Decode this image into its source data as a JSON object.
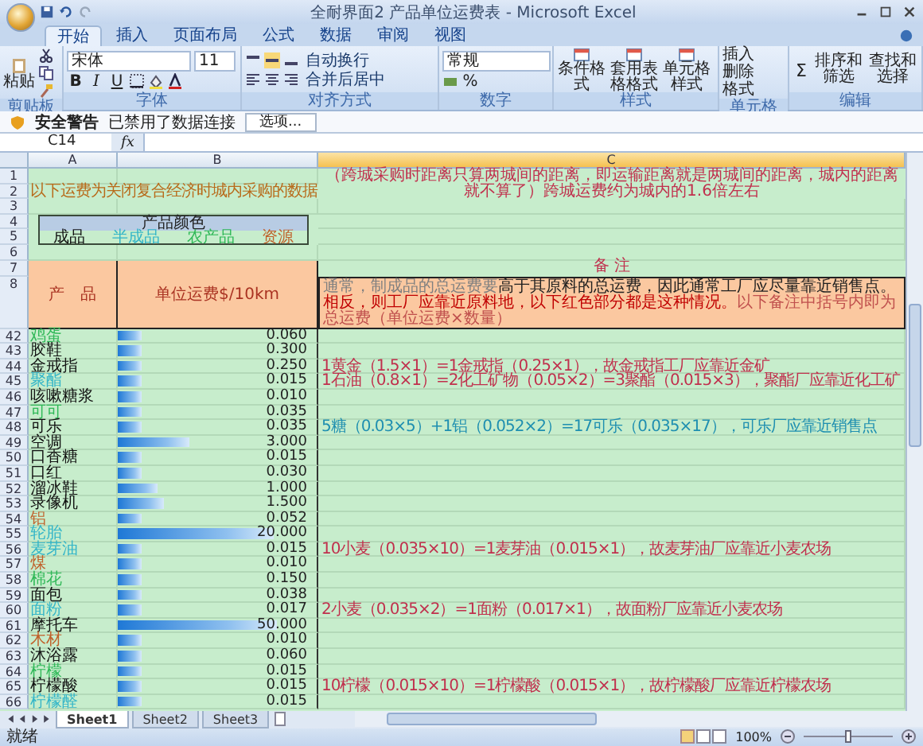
{
  "window": {
    "title": "全耐界面2 产品单位运费表 - Microsoft Excel"
  },
  "ribbon_tabs": [
    {
      "label": "开始",
      "selected": true
    },
    {
      "label": "插入",
      "selected": false
    },
    {
      "label": "页面布局",
      "selected": false
    },
    {
      "label": "公式",
      "selected": false
    },
    {
      "label": "数据",
      "selected": false
    },
    {
      "label": "审阅",
      "selected": false
    },
    {
      "label": "视图",
      "selected": false
    }
  ],
  "ribbon": {
    "clipboard": {
      "paste": "粘贴",
      "label": "剪贴板"
    },
    "font": {
      "name": "宋体",
      "size": "11",
      "format_buttons": [
        "B",
        "I",
        "U"
      ],
      "label": "字体"
    },
    "alignment": {
      "wrap": "自动换行",
      "merge": "合并后居中",
      "label": "对齐方式"
    },
    "number": {
      "format": "常规",
      "percent": "%",
      "label": "数字"
    },
    "styles": {
      "buttons": [
        "条件格式",
        "套用表格格式",
        "单元格样式"
      ],
      "label": "样式"
    },
    "cells": {
      "buttons": [
        "插入",
        "删除",
        "格式"
      ],
      "label": "单元格"
    },
    "editing": {
      "sum": "Σ",
      "buttons": [
        "排序和筛选",
        "查找和选择"
      ],
      "label": "编辑"
    }
  },
  "security_bar": {
    "title": "安全警告",
    "message": "已禁用了数据连接",
    "button": "选项..."
  },
  "formula_bar": {
    "name_box": "C14",
    "fx": "fx"
  },
  "columns": [
    "A",
    "B",
    "C"
  ],
  "sheet": {
    "top_row_numbers": [
      "1",
      "2",
      "3",
      "4",
      "5",
      "6",
      "7",
      "8"
    ],
    "note": "（跨城采购时距离只算两城间的距离，即运输距离就是两城间的距离，城内的距离就不算了）跨城运费约为城内的1.6倍左右",
    "intro": "以下运费为关闭复合经济时城内采购的数据",
    "legend": {
      "title": "产品颜色",
      "items": [
        {
          "label": "成品",
          "kind": "finished"
        },
        {
          "label": "半成品",
          "kind": "semi"
        },
        {
          "label": "农产品",
          "kind": "farm"
        },
        {
          "label": "资源",
          "kind": "resource"
        }
      ]
    },
    "header": {
      "product": "产　品",
      "cost": "单位运费$/10km",
      "remarks_title": "备 注",
      "remark": [
        {
          "text": "通常，制成品的总运费要",
          "color": "#808080"
        },
        {
          "text": "高于其原料的总运费，因此通常工厂应尽量靠近销售点。",
          "color": "#202020"
        },
        {
          "text": "相反，则工厂应靠近原料地，以下红色部分都是这种情况。",
          "color": "#c00000"
        },
        {
          "text": "以下备注中括号内即为总运费（单位运费×数量）",
          "color": "#c0504d"
        }
      ]
    },
    "rows": [
      {
        "row": "42",
        "name": "鸡蛋",
        "kind": "farm",
        "value": "0.060",
        "level": 0.12
      },
      {
        "row": "43",
        "name": "胶鞋",
        "kind": "finished",
        "value": "0.300",
        "level": 0.12
      },
      {
        "row": "44",
        "name": "金戒指",
        "kind": "finished",
        "value": "0.250",
        "level": 0.12,
        "remark": {
          "text": "1黄金（1.5×1）=1金戒指（0.25×1），故金戒指工厂应靠近金矿",
          "color": "#c0304d"
        }
      },
      {
        "row": "45",
        "name": "聚酯",
        "kind": "semi",
        "value": "0.015",
        "level": 0.12,
        "remark": {
          "text": "1石油（0.8×1）=2化工矿物（0.05×2）=3聚酯（0.015×3），聚酯厂应靠近化工矿",
          "color": "#c0304d"
        }
      },
      {
        "row": "46",
        "name": "咳嗽糖浆",
        "kind": "finished",
        "value": "0.010",
        "level": 0.12
      },
      {
        "row": "47",
        "name": "可可",
        "kind": "farm",
        "value": "0.035",
        "level": 0.12
      },
      {
        "row": "48",
        "name": "可乐",
        "kind": "finished",
        "value": "0.035",
        "level": 0.12,
        "remark": {
          "text": "5糖（0.03×5）+1铝（0.052×2）=17可乐（0.035×17），可乐厂应靠近销售点",
          "color": "#1f8fb0"
        }
      },
      {
        "row": "49",
        "name": "空调",
        "kind": "finished",
        "value": "3.000",
        "level": 0.36
      },
      {
        "row": "50",
        "name": "口香糖",
        "kind": "finished",
        "value": "0.015",
        "level": 0.12
      },
      {
        "row": "51",
        "name": "口红",
        "kind": "finished",
        "value": "0.030",
        "level": 0.12
      },
      {
        "row": "52",
        "name": "溜冰鞋",
        "kind": "finished",
        "value": "1.000",
        "level": 0.2
      },
      {
        "row": "53",
        "name": "录像机",
        "kind": "finished",
        "value": "1.500",
        "level": 0.23
      },
      {
        "row": "54",
        "name": "铝",
        "kind": "resource",
        "value": "0.052",
        "level": 0.12
      },
      {
        "row": "55",
        "name": "轮胎",
        "kind": "semi",
        "value": "20.000",
        "level": 0.78
      },
      {
        "row": "56",
        "name": "麦芽油",
        "kind": "semi",
        "value": "0.015",
        "level": 0.12,
        "remark": {
          "text": "10小麦（0.035×10）=1麦芽油（0.015×1），故麦芽油厂应靠近小麦农场",
          "color": "#c0304d"
        }
      },
      {
        "row": "57",
        "name": "煤",
        "kind": "resource",
        "value": "0.010",
        "level": 0.12
      },
      {
        "row": "58",
        "name": "棉花",
        "kind": "farm",
        "value": "0.150",
        "level": 0.12
      },
      {
        "row": "59",
        "name": "面包",
        "kind": "finished",
        "value": "0.038",
        "level": 0.12
      },
      {
        "row": "60",
        "name": "面粉",
        "kind": "semi",
        "value": "0.017",
        "level": 0.12,
        "remark": {
          "text": "2小麦（0.035×2）=1面粉（0.017×1），故面粉厂应靠近小麦农场",
          "color": "#c0304d"
        }
      },
      {
        "row": "61",
        "name": "摩托车",
        "kind": "finished",
        "value": "50.000",
        "level": 0.8
      },
      {
        "row": "62",
        "name": "木材",
        "kind": "resource",
        "value": "0.010",
        "level": 0.12
      },
      {
        "row": "63",
        "name": "沐浴露",
        "kind": "finished",
        "value": "0.060",
        "level": 0.12
      },
      {
        "row": "64",
        "name": "柠檬",
        "kind": "farm",
        "value": "0.015",
        "level": 0.12
      },
      {
        "row": "65",
        "name": "柠檬酸",
        "kind": "finished",
        "value": "0.015",
        "level": 0.12,
        "remark": {
          "text": "10柠檬（0.015×10）=1柠檬酸（0.015×1），故柠檬酸厂应靠近柠檬农场",
          "color": "#c0304d"
        }
      },
      {
        "row": "66",
        "name": "柠檬醛",
        "kind": "semi",
        "value": "0.015",
        "level": 0.12
      }
    ]
  },
  "sheet_tabs": [
    {
      "label": "Sheet1",
      "selected": true
    },
    {
      "label": "Sheet2",
      "selected": false
    },
    {
      "label": "Sheet3",
      "selected": false
    }
  ],
  "status_bar": {
    "text": "就绪",
    "zoom": "100%",
    "zoom_slider": {
      "level": 0.5
    }
  }
}
